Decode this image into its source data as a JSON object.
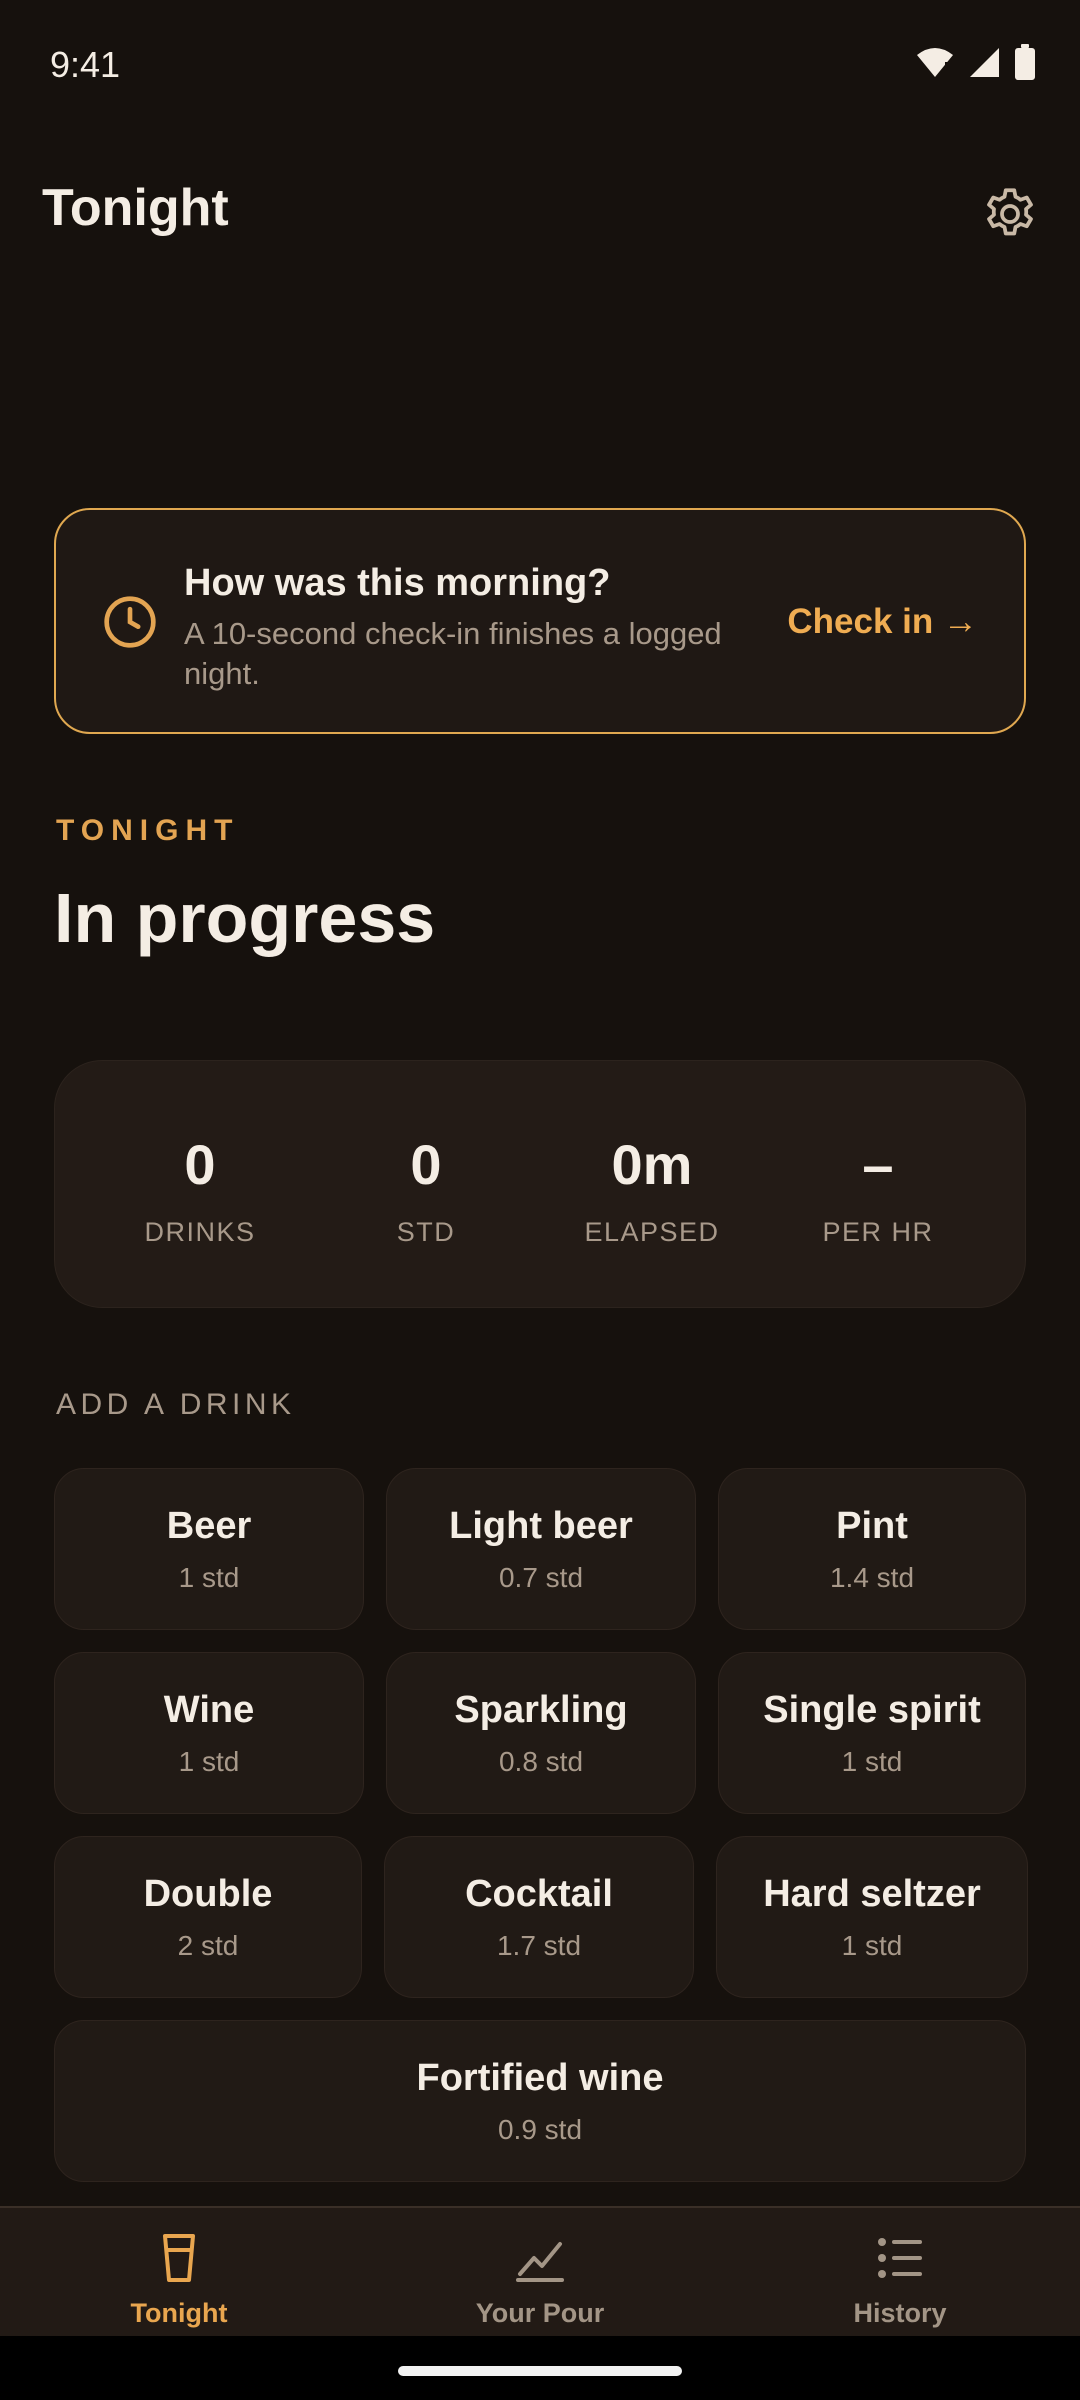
{
  "status_bar": {
    "time": "9:41"
  },
  "header": {
    "title": "Tonight",
    "settings_icon": "gear-icon"
  },
  "checkin_banner": {
    "title": "How was this morning?",
    "subtitle": "A 10-second check-in finishes a logged night.",
    "cta": "Check in →",
    "icon": "clock-icon"
  },
  "tonight": {
    "eyebrow": "TONIGHT",
    "status": "In progress",
    "stats": [
      {
        "value": "0",
        "label": "DRINKS"
      },
      {
        "value": "0",
        "label": "STD"
      },
      {
        "value": "0m",
        "label": "ELAPSED"
      },
      {
        "value": "–",
        "label": "PER HR"
      }
    ]
  },
  "add_drink": {
    "label": "ADD A DRINK",
    "drinks": [
      {
        "name": "Beer",
        "std": "1 std"
      },
      {
        "name": "Light beer",
        "std": "0.7 std"
      },
      {
        "name": "Pint",
        "std": "1.4 std"
      },
      {
        "name": "Wine",
        "std": "1 std"
      },
      {
        "name": "Sparkling",
        "std": "0.8 std"
      },
      {
        "name": "Single spirit",
        "std": "1 std"
      },
      {
        "name": "Double",
        "std": "2 std"
      },
      {
        "name": "Cocktail",
        "std": "1.7 std"
      },
      {
        "name": "Hard seltzer",
        "std": "1 std"
      },
      {
        "name": "Fortified wine",
        "std": "0.9 std"
      }
    ]
  },
  "bottom_nav": {
    "items": [
      {
        "label": "Tonight",
        "icon": "glass-icon",
        "active": true
      },
      {
        "label": "Your Pour",
        "icon": "chart-line-icon",
        "active": false
      },
      {
        "label": "History",
        "icon": "list-icon",
        "active": false
      }
    ]
  },
  "colors": {
    "accent": "#e9a64f",
    "background": "#16110d",
    "card": "#231b16",
    "muted": "#a8998a"
  }
}
